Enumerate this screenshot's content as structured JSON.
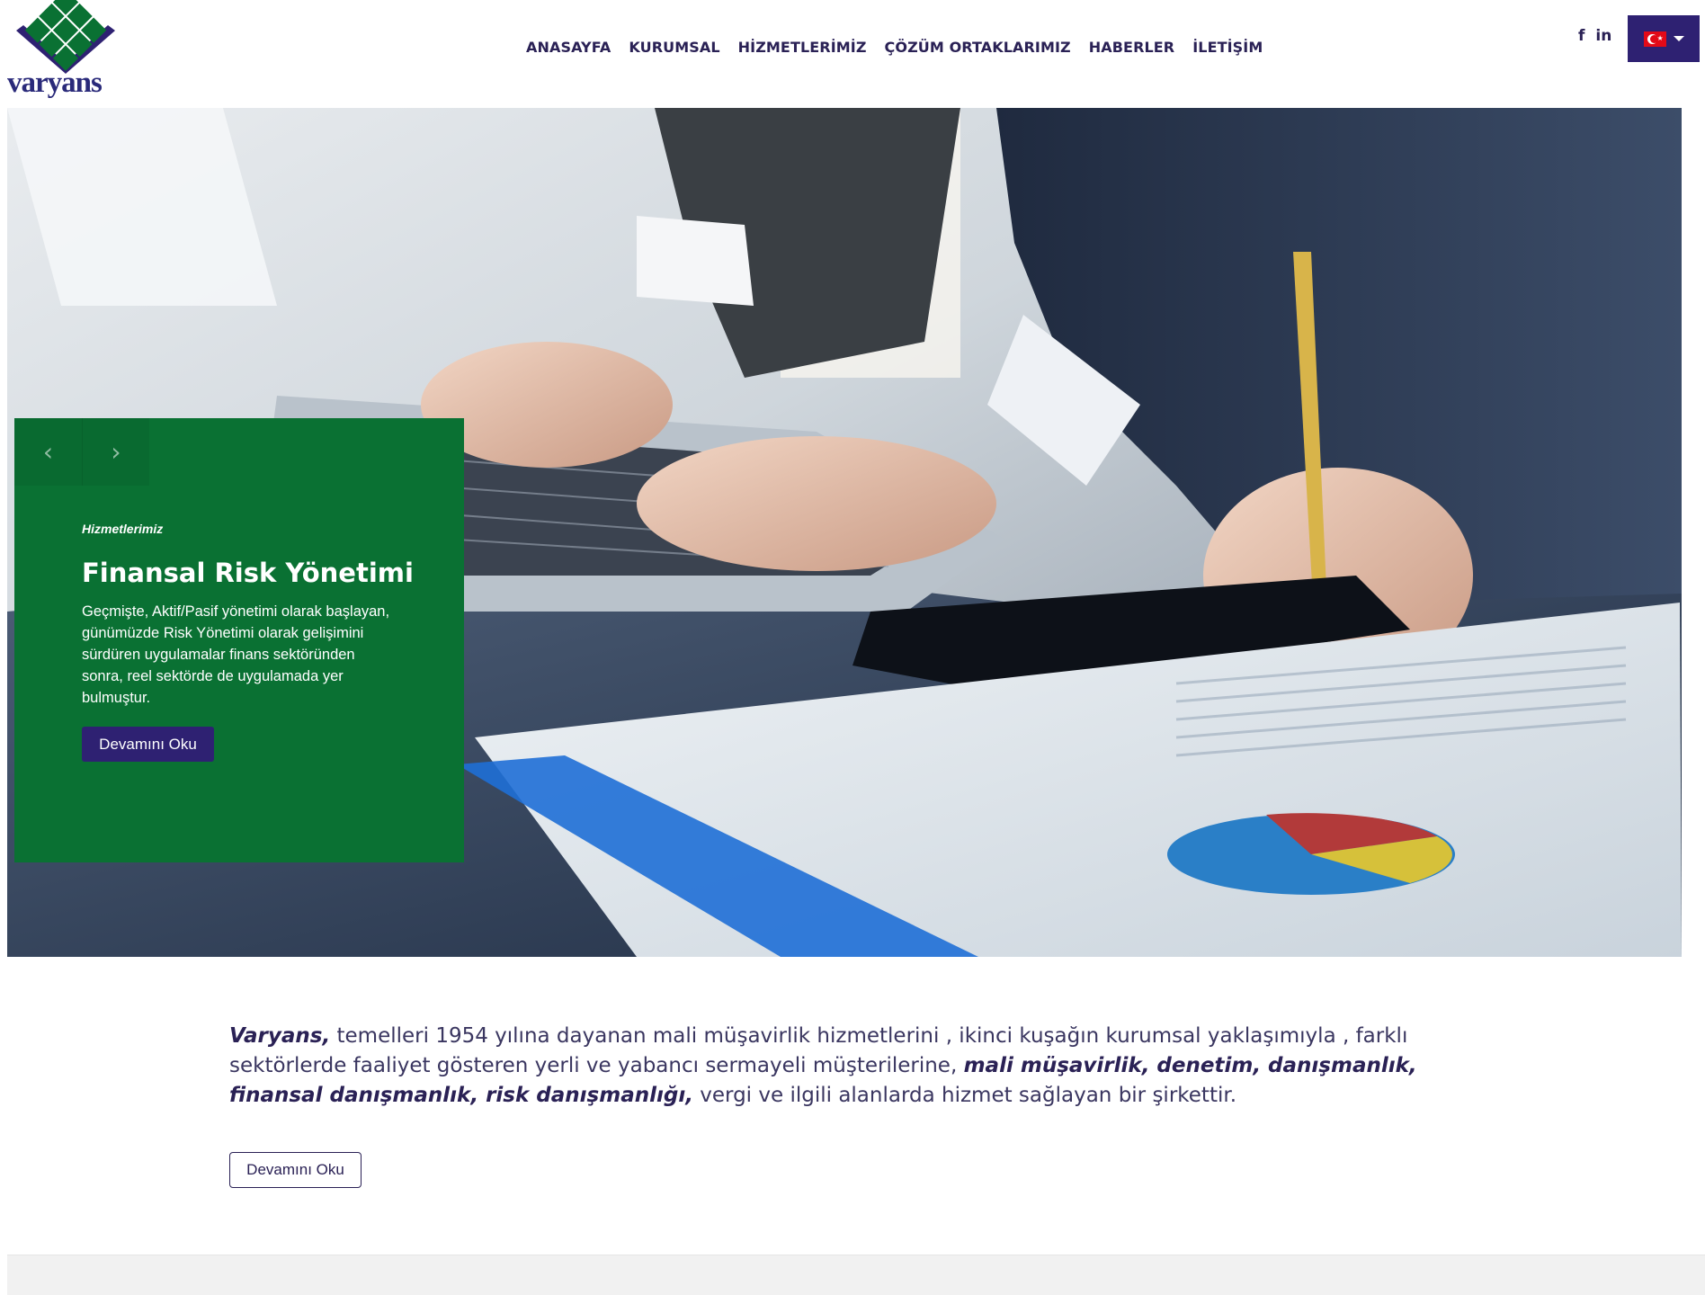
{
  "brand": {
    "logo_text": "varyans",
    "colors": {
      "primary": "#2e2172",
      "green": "#0a7133"
    }
  },
  "nav": {
    "items": [
      {
        "label": "ANASAYFA"
      },
      {
        "label": "KURUMSAL"
      },
      {
        "label": "HİZMETLERİMİZ"
      },
      {
        "label": "ÇÖZÜM ORTAKLARIMIZ"
      },
      {
        "label": "HABERLER"
      },
      {
        "label": "İLETİŞİM"
      }
    ]
  },
  "social": {
    "facebook": "f",
    "linkedin": "in"
  },
  "language": {
    "current": "tr-flag-icon"
  },
  "slider": {
    "prev_icon": "chevron-left-icon",
    "next_icon": "chevron-right-icon",
    "category": "Hizmetlerimiz",
    "title": "Finansal Risk Yönetimi",
    "description": "Geçmişte, Aktif/Pasif yönetimi olarak başlayan, günümüzde Risk Yönetimi olarak gelişimini sürdüren uygulamalar finans sektöründen sonra, reel sektörde de uygulamada yer bulmuştur.",
    "button_label": "Devamını Oku"
  },
  "intro": {
    "brand": "Varyans,",
    "text1": " temelleri 1954 yılına dayanan mali müşavirlik hizmetlerini , ikinci kuşağın kurumsal yaklaşımıyla , farklı sektörlerde faaliyet gösteren yerli ve yabancı sermayeli müşterilerine, ",
    "services": "mali müşavirlik, denetim, danışmanlık, finansal danışmanlık, risk danışmanlığı,",
    "text2": " vergi ve ilgili alanlarda hizmet sağlayan bir şirkettir.",
    "button_label": "Devamını Oku"
  }
}
